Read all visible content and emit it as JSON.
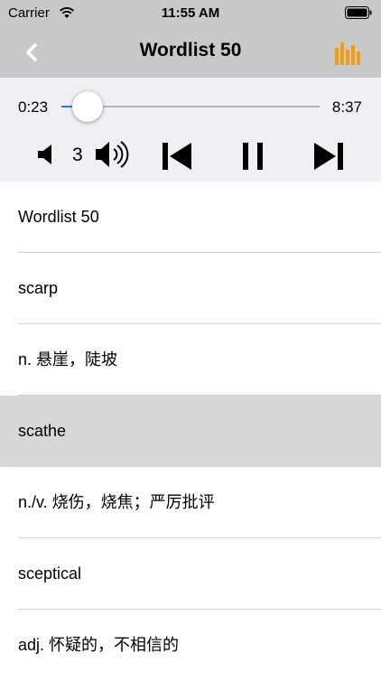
{
  "status_bar": {
    "carrier": "Carrier",
    "time": "11:55 AM"
  },
  "nav": {
    "title": "Wordlist 50",
    "back_icon": "chevron-left-icon",
    "bars_icon": "bar-chart-icon",
    "accent_color": "#f39c12"
  },
  "player": {
    "elapsed": "0:23",
    "duration": "8:37",
    "progress_fraction": 0.1,
    "volume": "3",
    "progress_color": "#1a82fb"
  },
  "list": {
    "items": [
      {
        "text": "Wordlist 50",
        "highlighted": false
      },
      {
        "text": "scarp",
        "highlighted": false
      },
      {
        "text": "n. 悬崖，陡坡",
        "highlighted": false
      },
      {
        "text": "scathe",
        "highlighted": true
      },
      {
        "text": "n./v. 烧伤，烧焦；严厉批评",
        "highlighted": false
      },
      {
        "text": "sceptical",
        "highlighted": false
      },
      {
        "text": "adj. 怀疑的，不相信的",
        "highlighted": false
      }
    ]
  }
}
